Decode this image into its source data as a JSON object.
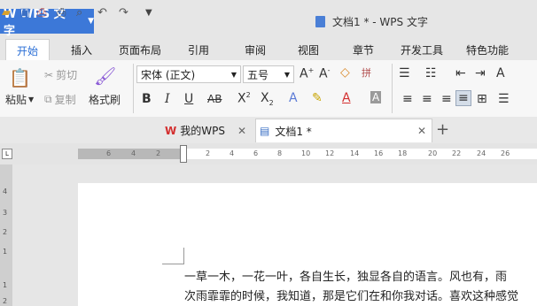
{
  "app": {
    "logo_text": "W WPS 文字",
    "document_title": "文档1 * - WPS 文字"
  },
  "ribbon_tabs": [
    "开始",
    "插入",
    "页面布局",
    "引用",
    "审阅",
    "视图",
    "章节",
    "开发工具",
    "特色功能"
  ],
  "clipboard": {
    "paste": "粘贴",
    "cut": "剪切",
    "copy": "复制",
    "format_painter": "格式刷"
  },
  "font": {
    "family": "宋体 (正文)",
    "size": "五号"
  },
  "doc_tabs": {
    "wps": "我的WPS",
    "doc": "文档1 *"
  },
  "ruler_labels": [
    "6",
    "4",
    "2",
    "2",
    "4",
    "6",
    "8",
    "10",
    "12",
    "14",
    "16",
    "18",
    "20",
    "22",
    "24",
    "26"
  ],
  "vruler_labels": [
    "4",
    "3",
    "2",
    "1",
    "1",
    "2"
  ],
  "content": {
    "line1": "一草一木，一花一叶，各自生长，独显各自的语言。风也有，雨",
    "line2": "次雨霏霏的时候，我知道，那是它们在和你我对话。喜欢这种感觉"
  }
}
